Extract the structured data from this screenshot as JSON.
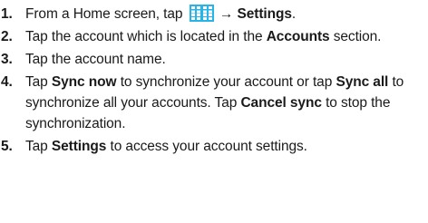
{
  "steps": [
    {
      "number": "1.",
      "text": {
        "before": "From a Home screen, tap",
        "arrow": "→",
        "settings": "Settings",
        "period": "."
      },
      "icon": "apps-grid-icon"
    },
    {
      "number": "2.",
      "text": {
        "before": "Tap the account which is located in the",
        "accounts": "Accounts",
        "after": "section."
      }
    },
    {
      "number": "3.",
      "text": {
        "full": "Tap the account name."
      }
    },
    {
      "number": "4.",
      "text": {
        "tap1": "Tap",
        "sync_now": "Sync now",
        "mid1": "to synchronize your account or tap",
        "sync_all": "Sync all",
        "mid2": "to synchronize all your accounts. Tap",
        "cancel_sync": "Cancel sync",
        "end": "to stop the synchronization."
      }
    },
    {
      "number": "5.",
      "text": {
        "tap": "Tap",
        "settings": "Settings",
        "after": "to access your account settings."
      }
    }
  ],
  "colors": {
    "apps_icon": "#29b4e8",
    "text": "#1a1a1a"
  }
}
